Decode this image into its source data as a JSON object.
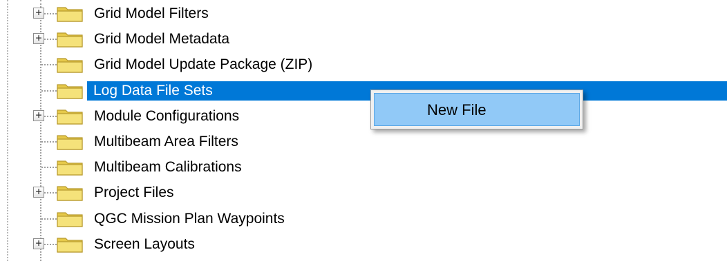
{
  "tree": {
    "items": [
      {
        "label": "Grid Model Filters",
        "expandable": true,
        "selected": false
      },
      {
        "label": "Grid Model Metadata",
        "expandable": true,
        "selected": false
      },
      {
        "label": "Grid Model Update Package (ZIP)",
        "expandable": false,
        "selected": false
      },
      {
        "label": "Log Data File Sets",
        "expandable": false,
        "selected": true
      },
      {
        "label": "Module Configurations",
        "expandable": true,
        "selected": false
      },
      {
        "label": "Multibeam Area Filters",
        "expandable": false,
        "selected": false
      },
      {
        "label": "Multibeam Calibrations",
        "expandable": false,
        "selected": false
      },
      {
        "label": "Project Files",
        "expandable": true,
        "selected": false
      },
      {
        "label": "QGC Mission Plan Waypoints",
        "expandable": false,
        "selected": false
      },
      {
        "label": "Screen Layouts",
        "expandable": true,
        "selected": false
      }
    ],
    "expander_glyph": "+",
    "icon": "folder-icon"
  },
  "context_menu": {
    "items": [
      {
        "label": "New File",
        "highlighted": true
      }
    ]
  },
  "colors": {
    "selection": "#0078d7",
    "menu_highlight": "#91c9f7",
    "folder_body": "#f5e27a",
    "folder_border": "#b89a2e"
  }
}
